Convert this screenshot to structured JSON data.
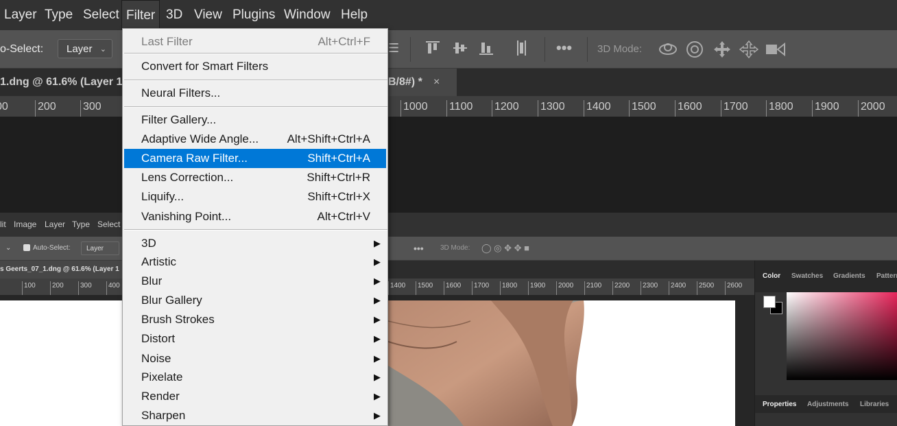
{
  "menubar": {
    "items": [
      "Layer",
      "Type",
      "Select",
      "Filter",
      "3D",
      "View",
      "Plugins",
      "Window",
      "Help"
    ]
  },
  "options": {
    "auto_select_label": "o-Select:",
    "layer_dropdown": "Layer",
    "three_d_mode": "3D Mode:"
  },
  "tabs": {
    "doc_left": "1.dng @ 61.6% (Layer 1",
    "doc_right": "B/8#) *",
    "close": "×"
  },
  "ruler": [
    "00",
    "200",
    "300",
    "1000",
    "1100",
    "1200",
    "1300",
    "1400",
    "1500",
    "1600",
    "1700",
    "1800",
    "1900",
    "2000"
  ],
  "nested": {
    "menu": [
      "lit",
      "Image",
      "Layer",
      "Type",
      "Select"
    ],
    "auto_select": "Auto-Select:",
    "layer": "Layer",
    "three_d_mode": "3D Mode:",
    "doc_tab": "s Geerts_07_1.dng @ 61.6% (Layer 1",
    "ruler": [
      "100",
      "200",
      "300",
      "400",
      "1400",
      "1500",
      "1600",
      "1700",
      "1800",
      "1900",
      "2000",
      "2100",
      "2200",
      "2300",
      "2400",
      "2500",
      "2600"
    ],
    "panel_tabs_top": [
      "Color",
      "Swatches",
      "Gradients",
      "Patterns"
    ],
    "panel_tabs_bottom": [
      "Properties",
      "Adjustments",
      "Libraries"
    ]
  },
  "filter_menu": {
    "last_filter": {
      "label": "Last Filter",
      "shortcut": "Alt+Ctrl+F"
    },
    "convert": {
      "label": "Convert for Smart Filters"
    },
    "neural": {
      "label": "Neural Filters..."
    },
    "items": [
      {
        "label": "Filter Gallery...",
        "shortcut": ""
      },
      {
        "label": "Adaptive Wide Angle...",
        "shortcut": "Alt+Shift+Ctrl+A"
      },
      {
        "label": "Camera Raw Filter...",
        "shortcut": "Shift+Ctrl+A"
      },
      {
        "label": "Lens Correction...",
        "shortcut": "Shift+Ctrl+R"
      },
      {
        "label": "Liquify...",
        "shortcut": "Shift+Ctrl+X"
      },
      {
        "label": "Vanishing Point...",
        "shortcut": "Alt+Ctrl+V"
      }
    ],
    "submenus": [
      "3D",
      "Artistic",
      "Blur",
      "Blur Gallery",
      "Brush Strokes",
      "Distort",
      "Noise",
      "Pixelate",
      "Render",
      "Sharpen"
    ]
  },
  "colors": {
    "highlight": "#0078d7",
    "menu_bg": "#f0f0f0"
  }
}
